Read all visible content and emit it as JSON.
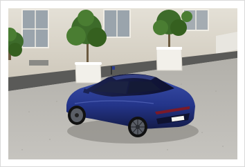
{
  "image": {
    "subject": "blue-crossover-car",
    "plate_text": "",
    "palette": {
      "car_body": "#2a3a8c",
      "car_shadow": "#141c4a",
      "facade": "#d9d4c8",
      "courtyard": "#b9b7b1",
      "planter": "#f2f0ea",
      "foliage": "#3d6b2a",
      "frame_border": "#d9d9d9"
    }
  }
}
